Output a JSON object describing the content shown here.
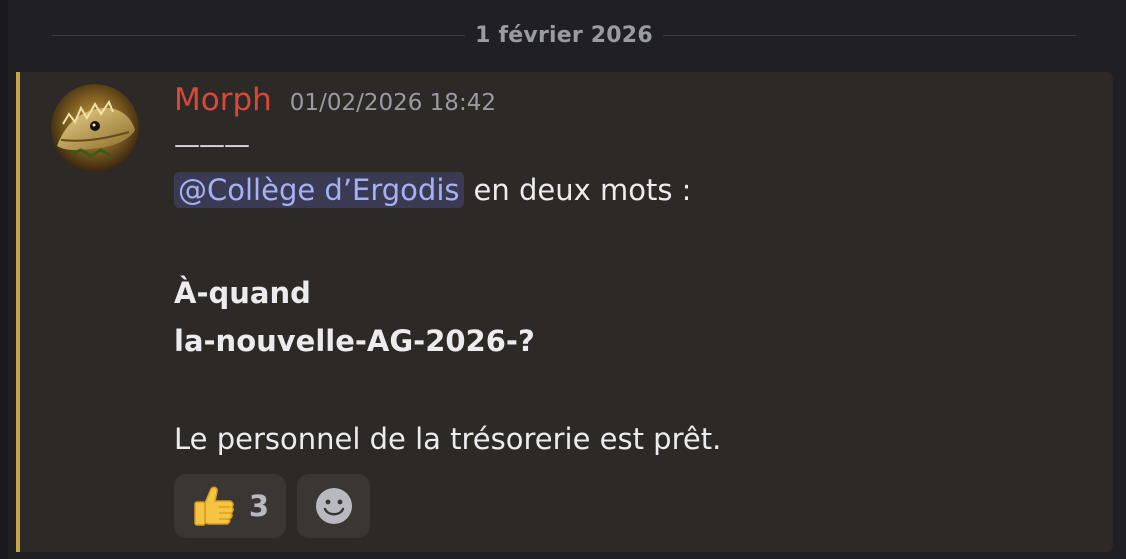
{
  "divider": {
    "date": "1 février 2026"
  },
  "message": {
    "author": "Morph",
    "timestamp": "01/02/2026 18:42",
    "dashes": "———",
    "mention": "@Collège d’Ergodis",
    "after_mention": "en deux mots :",
    "bold_line_1": "À-quand",
    "bold_line_2": "la-nouvelle-AG-2026-?",
    "plain_line": "Le personnel de la trésorerie est prêt."
  },
  "reactions": [
    {
      "emoji": "thumbs-up-icon",
      "count": "3"
    }
  ],
  "add_reaction_icon": "smiley-face-icon",
  "colors": {
    "username": "#d9493b",
    "accent_bar": "#c9a24a",
    "mention_bg": "#3a3b52",
    "mention_text": "#a7b0f5",
    "message_bg": "#2c2926"
  }
}
